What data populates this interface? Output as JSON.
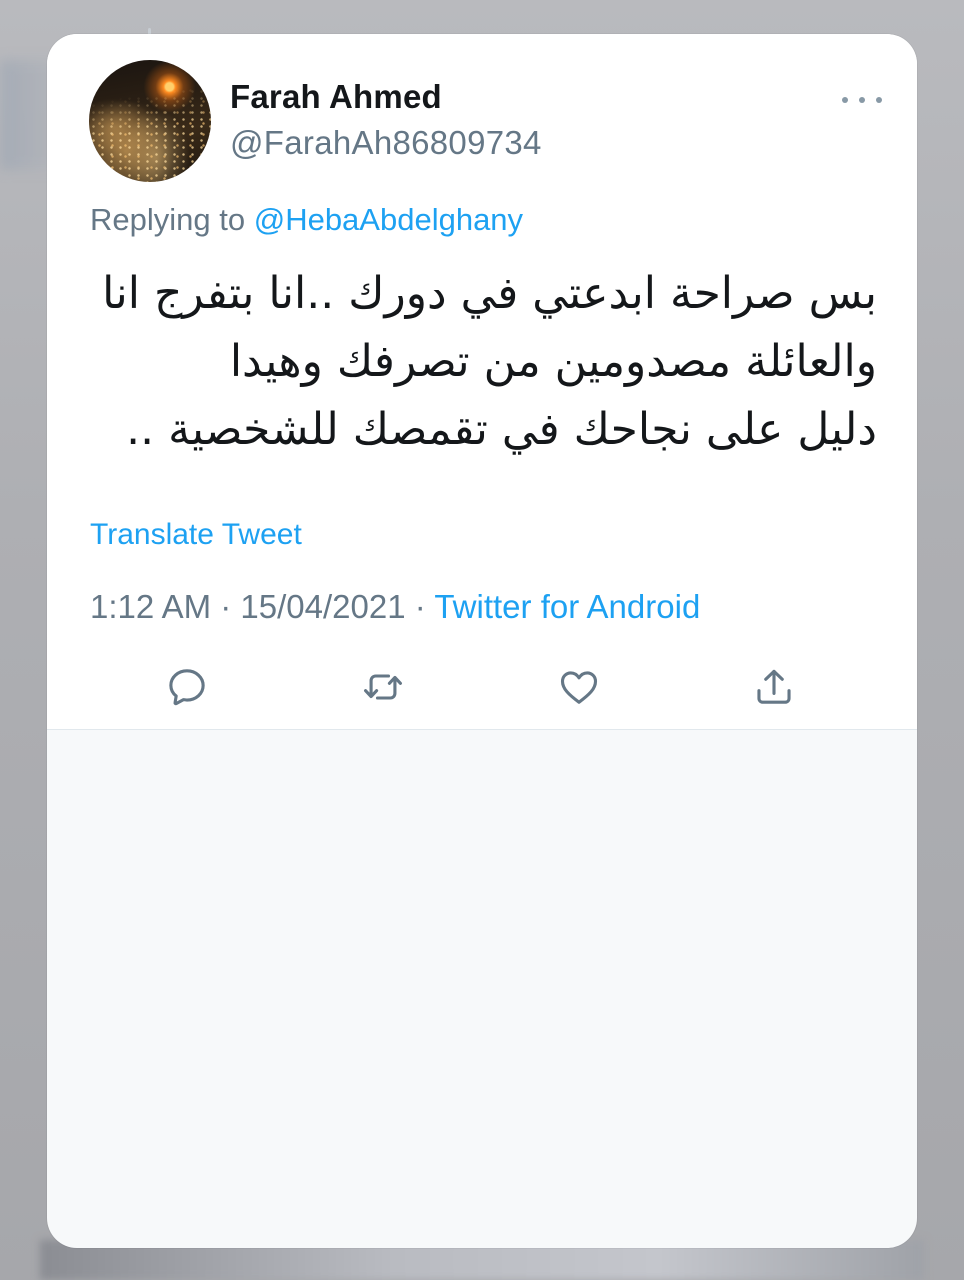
{
  "tweet": {
    "author_name": "Farah Ahmed",
    "author_handle": "@FarahAh86809734",
    "replying_prefix": "Replying to",
    "replying_to": "@HebaAbdelghany",
    "text_lines": [
      "بس صراحة ابدعتي في دورك ..انا بتفرج انا",
      "والعائلة مصدومين من تصرفك وهيدا",
      "دليل على نجاحك في تقمصك للشخصية .."
    ],
    "translate_label": "Translate Tweet",
    "time": "1:12 AM",
    "separator": "·",
    "date": "15/04/2021",
    "source": "Twitter for Android"
  },
  "icons": {
    "more": "more-horizontal-icon",
    "reply": "reply-bubble-icon",
    "retweet": "retweet-icon",
    "like": "heart-icon",
    "share": "share-upload-icon"
  },
  "colors": {
    "accent": "#1da1f2",
    "text_primary": "#14171a",
    "text_secondary": "#657786",
    "icon": "#657786"
  }
}
